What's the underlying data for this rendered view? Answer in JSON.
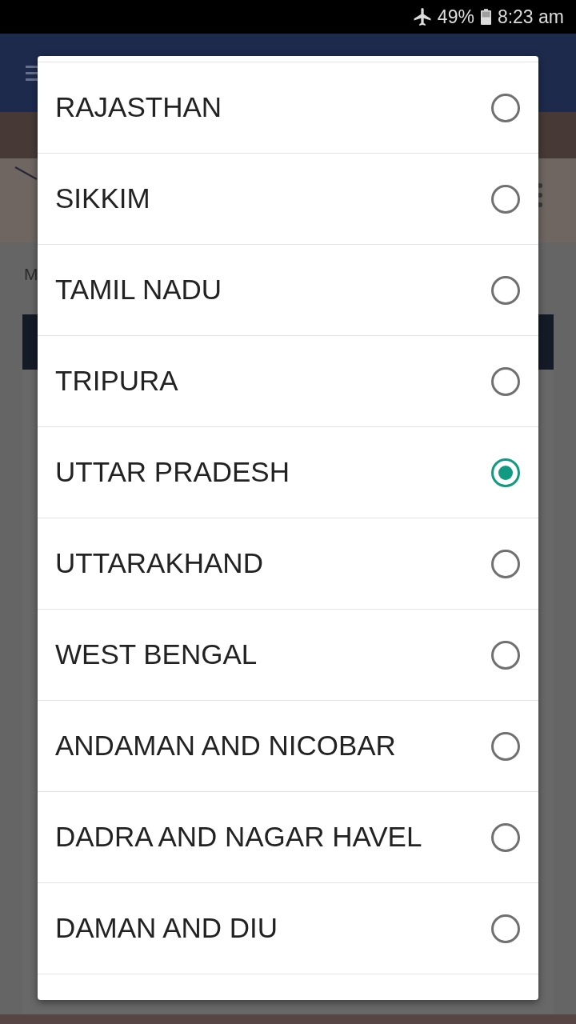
{
  "status_bar": {
    "battery": "49%",
    "time": "8:23 am"
  },
  "background": {
    "label": "M"
  },
  "dialog": {
    "options": [
      {
        "label": "RAJASTHAN",
        "selected": false
      },
      {
        "label": "SIKKIM",
        "selected": false
      },
      {
        "label": "TAMIL NADU",
        "selected": false
      },
      {
        "label": "TRIPURA",
        "selected": false
      },
      {
        "label": "UTTAR PRADESH",
        "selected": true
      },
      {
        "label": "UTTARAKHAND",
        "selected": false
      },
      {
        "label": "WEST BENGAL",
        "selected": false
      },
      {
        "label": "ANDAMAN AND NICOBAR",
        "selected": false
      },
      {
        "label": "DADRA AND NAGAR HAVEL",
        "selected": false
      },
      {
        "label": "DAMAN AND DIU",
        "selected": false
      }
    ]
  }
}
